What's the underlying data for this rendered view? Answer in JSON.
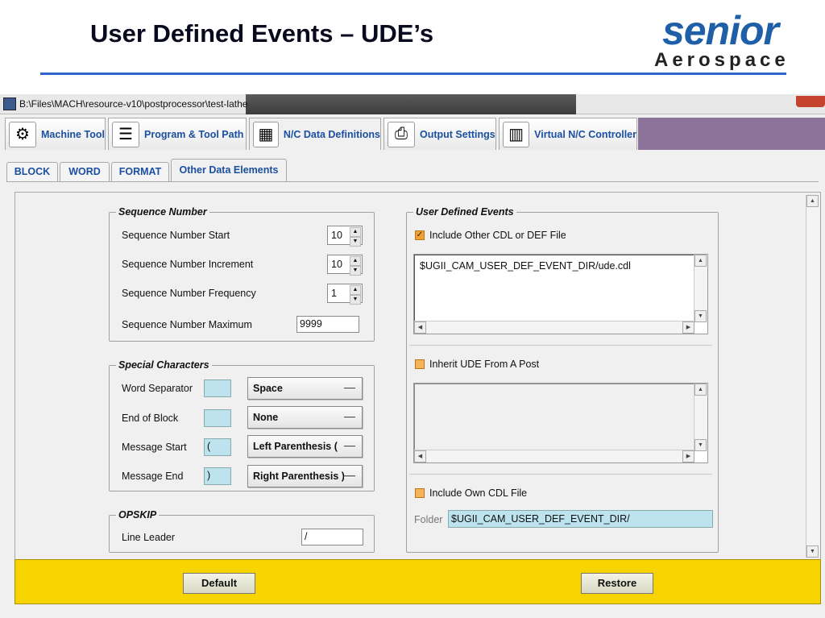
{
  "slide": {
    "title": "User Defined Events – UDE’s",
    "logo_senior": "senior",
    "logo_aerospace": "Aerospace"
  },
  "window": {
    "title": "B:\\Files\\MACH\\resource-v10\\postprocessor\\test-lathe"
  },
  "main_tabs": [
    {
      "label": "Machine Tool",
      "icon": "machine-tool-icon"
    },
    {
      "label": "Program & Tool Path",
      "icon": "program-tool-path-icon"
    },
    {
      "label": "N/C Data Definitions",
      "icon": "nc-data-definitions-icon"
    },
    {
      "label": "Output Settings",
      "icon": "printer-icon"
    },
    {
      "label": "Virtual N/C Controller",
      "icon": "virtual-nc-controller-icon"
    }
  ],
  "sub_tabs": [
    "BLOCK",
    "WORD",
    "FORMAT",
    "Other Data Elements"
  ],
  "sequence_number": {
    "legend": "Sequence Number",
    "start_label": "Sequence Number Start",
    "start_value": "10",
    "increment_label": "Sequence Number Increment",
    "increment_value": "10",
    "frequency_label": "Sequence Number Frequency",
    "frequency_value": "1",
    "maximum_label": "Sequence Number Maximum",
    "maximum_value": "9999"
  },
  "special_characters": {
    "legend": "Special Characters",
    "rows": [
      {
        "label": "Word Separator",
        "char": "",
        "option": "Space"
      },
      {
        "label": "End of Block",
        "char": "",
        "option": "None"
      },
      {
        "label": "Message Start",
        "char": "(",
        "option": "Left Parenthesis ("
      },
      {
        "label": "Message End",
        "char": ")",
        "option": "Right Parenthesis )"
      }
    ]
  },
  "opskip": {
    "legend": "OPSKIP",
    "line_leader_label": "Line Leader",
    "line_leader_value": "/"
  },
  "user_defined_events": {
    "legend": "User Defined Events",
    "include_other_label": "Include Other CDL or DEF File",
    "include_other_checked": true,
    "include_other_path": "$UGII_CAM_USER_DEF_EVENT_DIR/ude.cdl",
    "inherit_label": "Inherit UDE From A Post",
    "inherit_checked": false,
    "include_own_label": "Include Own CDL File",
    "include_own_checked": false,
    "folder_label": "Folder",
    "folder_value": "$UGII_CAM_USER_DEF_EVENT_DIR/"
  },
  "footer": {
    "default_label": "Default",
    "restore_label": "Restore"
  },
  "colors": {
    "tab_text": "#1b4fa0",
    "footer_bg": "#f7d300",
    "checkbox": "#f4a030",
    "field_highlight": "#bde3ee",
    "title_rule": "#2f63c8"
  }
}
